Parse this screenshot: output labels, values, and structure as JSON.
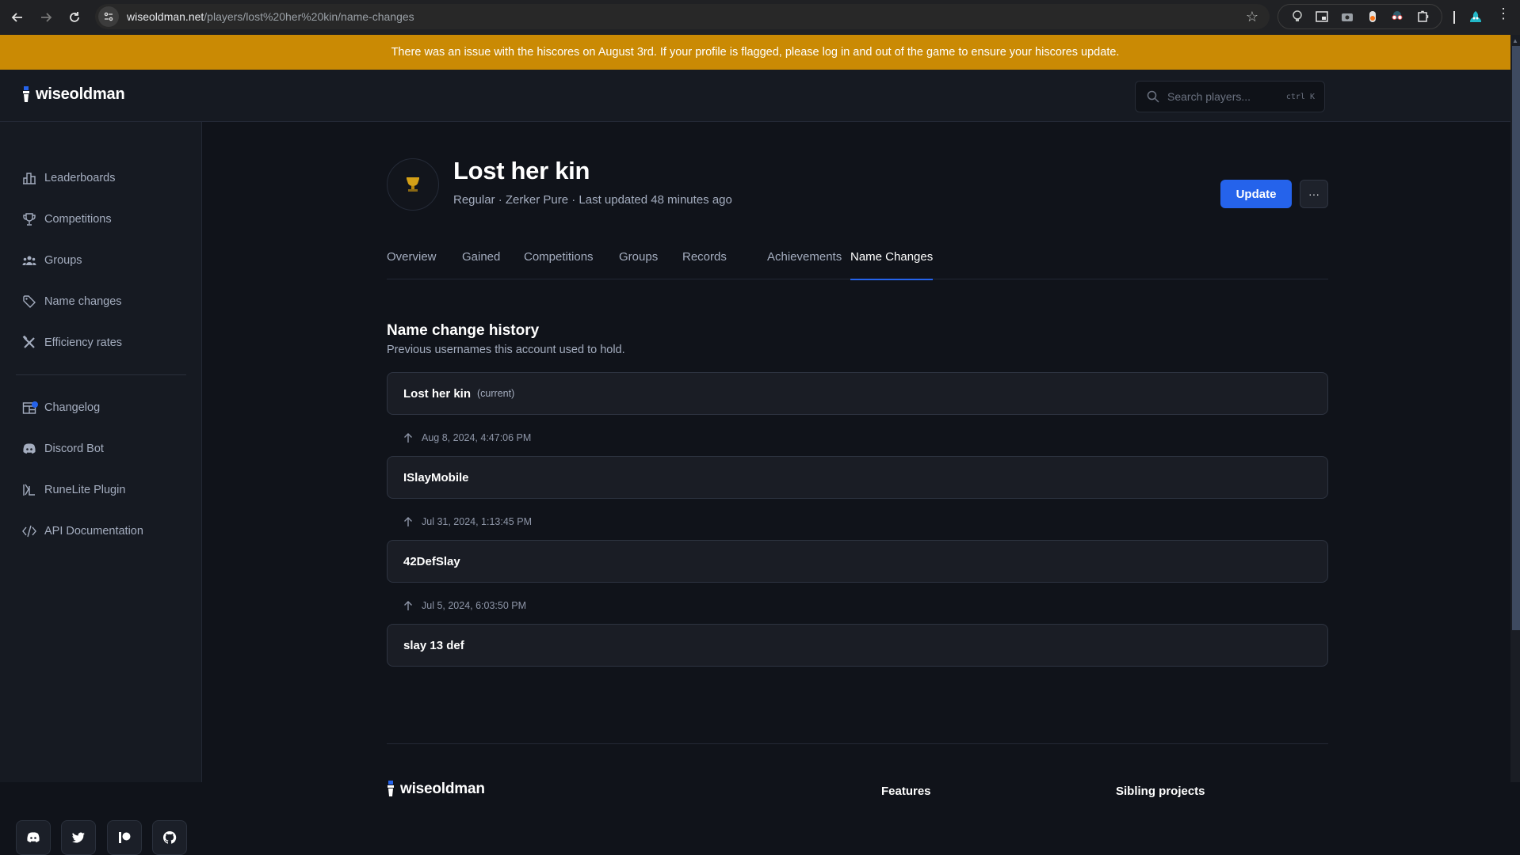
{
  "browser": {
    "url_host": "wiseoldman.net",
    "url_path": "/players/lost%20her%20kin/name-changes"
  },
  "banner": {
    "text": "There was an issue with the hiscores on August 3rd. If your profile is flagged, please log in and out of the game to ensure your hiscores update.",
    "color": "#ca8a04"
  },
  "header": {
    "logo_text": "wiseoldman",
    "search": {
      "placeholder": "Search players...",
      "value": "",
      "shortcut": "ctrl K"
    }
  },
  "sidebar": {
    "primary_items": [
      {
        "label": "Leaderboards",
        "icon": "bar-chart-icon"
      },
      {
        "label": "Competitions",
        "icon": "trophy-icon"
      },
      {
        "label": "Groups",
        "icon": "users-icon"
      },
      {
        "label": "Name changes",
        "icon": "tag-icon"
      },
      {
        "label": "Efficiency rates",
        "icon": "tools-icon"
      }
    ],
    "secondary_items": [
      {
        "label": "Changelog",
        "icon": "calendar-icon",
        "has_notification": true
      },
      {
        "label": "Discord Bot",
        "icon": "discord-icon"
      },
      {
        "label": "RuneLite Plugin",
        "icon": "runelite-icon"
      },
      {
        "label": "API Documentation",
        "icon": "code-icon"
      }
    ],
    "social_links": [
      "discord-icon",
      "twitter-icon",
      "patreon-icon",
      "github-icon"
    ]
  },
  "player": {
    "name": "Lost her kin",
    "meta": "Regular · Zerker Pure · Last updated 48 minutes ago",
    "update_label": "Update",
    "more_label": "···"
  },
  "tabs": [
    {
      "label": "Overview",
      "active": false
    },
    {
      "label": "Gained",
      "active": false
    },
    {
      "label": "Competitions",
      "active": false
    },
    {
      "label": "Groups",
      "active": false
    },
    {
      "label": "Records",
      "active": false
    },
    {
      "label": "Achievements",
      "active": false
    },
    {
      "label": "Name Changes",
      "active": true
    }
  ],
  "name_history": {
    "title": "Name change history",
    "subtitle": "Previous usernames this account used to hold.",
    "current_tag": "(current)",
    "names": [
      "Lost her kin",
      "ISlayMobile",
      "42DefSlay",
      "slay 13 def"
    ],
    "change_dates": [
      "Aug 8, 2024, 4:47:06 PM",
      "Jul 31, 2024, 1:13:45 PM",
      "Jul 5, 2024, 6:03:50 PM"
    ]
  },
  "footer": {
    "logo_text": "wiseoldman",
    "headings": [
      "Features",
      "Sibling projects"
    ]
  },
  "colors": {
    "accent": "#2563eb",
    "background": "#10131a",
    "surface": "#161a22",
    "banner": "#ca8a04"
  }
}
